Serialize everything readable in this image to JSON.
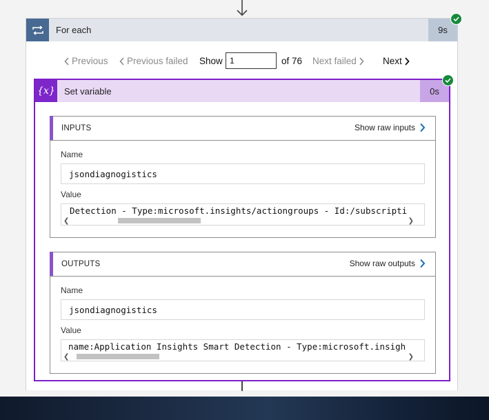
{
  "foreach": {
    "title": "For each",
    "duration": "9s",
    "icon": "loop-icon",
    "status": "succeeded"
  },
  "pager": {
    "previous_label": "Previous",
    "previous_failed_label": "Previous failed",
    "show_label": "Show",
    "current_page": "1",
    "of_label": "of 76",
    "next_failed_label": "Next failed",
    "next_label": "Next"
  },
  "set_variable": {
    "icon_text": "{x}",
    "title": "Set variable",
    "duration": "0s",
    "status": "succeeded",
    "inputs": {
      "header": "INPUTS",
      "raw_link": "Show raw inputs",
      "name_label": "Name",
      "name_value": "jsondiagnogistics",
      "value_label": "Value",
      "value_text": "Detection - Type:microsoft.insights/actiongroups - Id:/subscripti"
    },
    "outputs": {
      "header": "OUTPUTS",
      "raw_link": "Show raw outputs",
      "name_label": "Name",
      "name_value": "jsondiagnogistics",
      "value_label": "Value",
      "value_text": "name:Application Insights Smart Detection - Type:microsoft.insigh"
    }
  },
  "colors": {
    "foreach_accent": "#486991",
    "setvar_accent": "#7d26c9",
    "success": "#168a3b",
    "link_chevron": "#0f6cbd"
  }
}
